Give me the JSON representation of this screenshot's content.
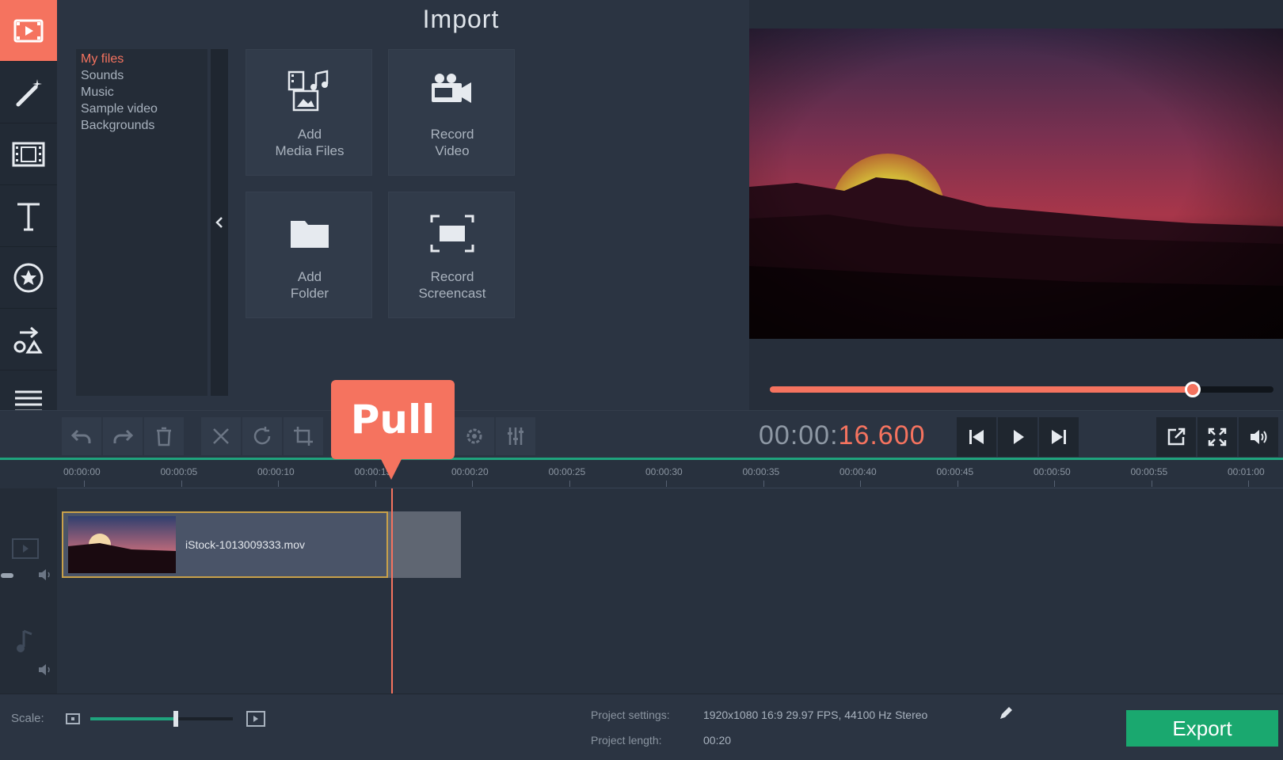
{
  "import": {
    "title": "Import",
    "categories": [
      "My files",
      "Sounds",
      "Music",
      "Sample video",
      "Backgrounds"
    ],
    "tiles": [
      {
        "line1": "Add",
        "line2": "Media Files",
        "icon": "add-media-icon"
      },
      {
        "line1": "Record",
        "line2": "Video",
        "icon": "video-camera-icon"
      },
      {
        "line1": "Add",
        "line2": "Folder",
        "icon": "folder-icon"
      },
      {
        "line1": "Record",
        "line2": "Screencast",
        "icon": "screencast-icon"
      }
    ]
  },
  "sidebar": {
    "tools": [
      "import-icon",
      "magic-wand-icon",
      "filmstrip-icon",
      "text-icon",
      "sticker-icon",
      "transitions-icon",
      "menu-icon"
    ],
    "active": "import-icon"
  },
  "player": {
    "timecode_main": "00:00:",
    "timecode_accent": "16.600",
    "seek_fraction": 0.84
  },
  "callout": {
    "text": "Pull"
  },
  "timeline": {
    "ticks": [
      "00:00:00",
      "00:00:05",
      "00:00:10",
      "00:00:15",
      "00:00:20",
      "00:00:25",
      "00:00:30",
      "00:00:35",
      "00:00:40",
      "00:00:45",
      "00:00:50",
      "00:00:55",
      "00:01:00"
    ],
    "clip_name": "iStock-1013009333.mov"
  },
  "status": {
    "scale_label": "Scale:",
    "scale_fraction": 0.6,
    "project_settings_label": "Project settings:",
    "project_settings_value": "1920x1080 16:9 29.97 FPS, 44100 Hz Stereo",
    "project_length_label": "Project length:",
    "project_length_value": "00:20",
    "export_label": "Export"
  },
  "colors": {
    "accent": "#f5735f",
    "export_green": "#1aa86f",
    "panel": "#2b3442"
  }
}
